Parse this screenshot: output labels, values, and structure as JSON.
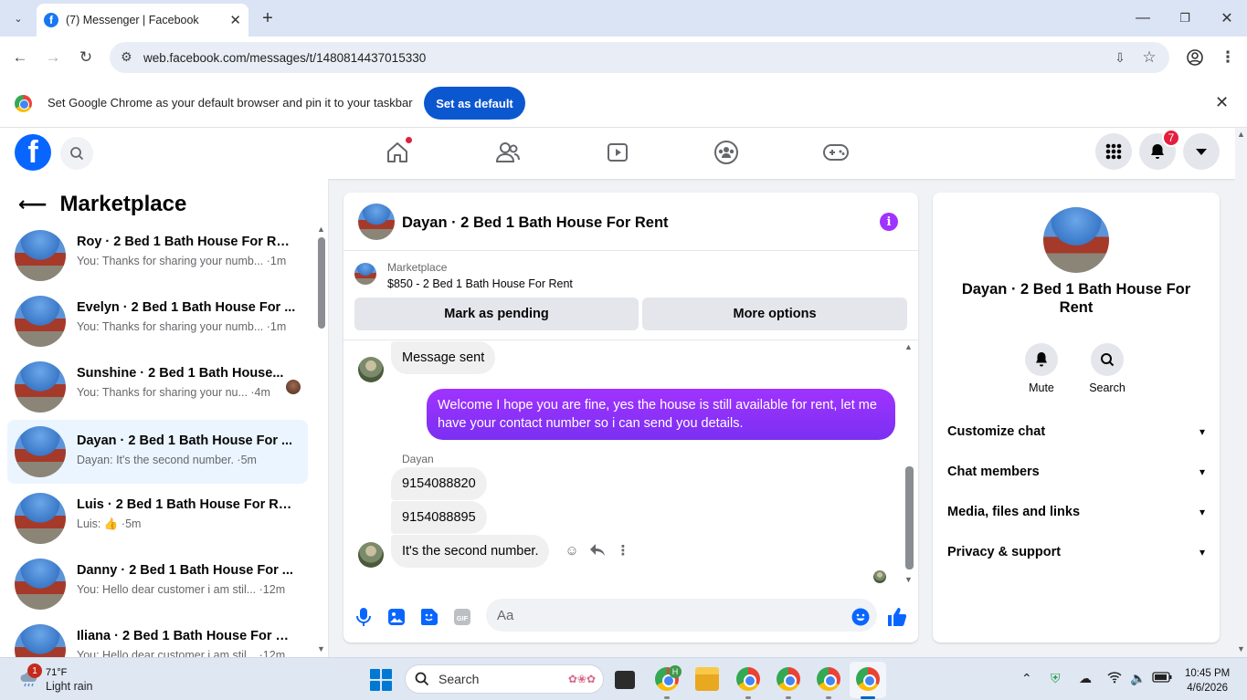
{
  "browser": {
    "tab_title": "(7) Messenger | Facebook",
    "url": "web.facebook.com/messages/t/1480814437015330",
    "infobar_text": "Set Google Chrome as your default browser and pin it to your taskbar",
    "set_default_label": "Set as default"
  },
  "fb": {
    "logo": "f",
    "notification_count": "7"
  },
  "sidebar": {
    "title": "Marketplace",
    "conversations": [
      {
        "name": "Roy · 2 Bed 1 Bath House For Rent",
        "preview": "You: Thanks for sharing your numb... ·1m"
      },
      {
        "name": "Evelyn · 2 Bed 1 Bath House For ...",
        "preview": "You: Thanks for sharing your numb... ·1m"
      },
      {
        "name": "Sunshine · 2 Bed 1 Bath House...",
        "preview": "You: Thanks for sharing your nu... ·4m"
      },
      {
        "name": "Dayan · 2 Bed 1 Bath House For ...",
        "preview": "Dayan: It's the second number. ·5m"
      },
      {
        "name": "Luis · 2 Bed 1 Bath House For Rent",
        "preview": "Luis: 👍 ·5m"
      },
      {
        "name": "Danny · 2 Bed 1 Bath House For ...",
        "preview": "You: Hello dear customer i am stil... ·12m"
      },
      {
        "name": "Iliana · 2 Bed 1 Bath House For R...",
        "preview": "You: Hello dear customer i am stil... ·12m"
      }
    ]
  },
  "chat": {
    "title": "Dayan · 2 Bed 1 Bath House For Rent",
    "marketplace_label": "Marketplace",
    "listing": "$850 - 2 Bed 1 Bath House For Rent",
    "mark_pending": "Mark as pending",
    "more_options": "More options",
    "messages": {
      "sent_notice": "Message sent",
      "outgoing": "Welcome I hope you are fine, yes the house is still available for rent, let me have your contact number so i can send you  details.",
      "sender": "Dayan",
      "num1": "9154088820",
      "num2": "9154088895",
      "last": "It's the second number."
    },
    "input_placeholder": "Aa"
  },
  "info_panel": {
    "name": "Dayan · 2 Bed 1 Bath House For Rent",
    "mute": "Mute",
    "search": "Search",
    "rows": [
      "Customize chat",
      "Chat members",
      "Media, files and links",
      "Privacy & support"
    ]
  },
  "taskbar": {
    "weather_badge": "1",
    "temp": "71°F",
    "condition": "Light rain",
    "search": "Search",
    "time": "10:45 PM",
    "date": "4/6/2026",
    "chrome_badge": "H"
  }
}
